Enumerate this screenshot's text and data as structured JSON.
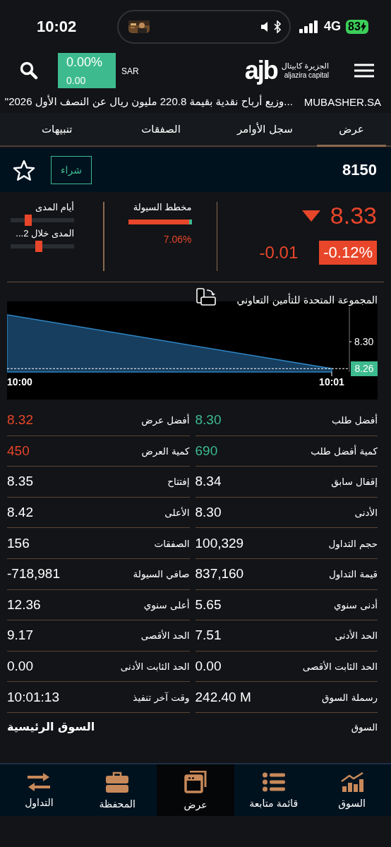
{
  "status_bar": {
    "time": "10:02",
    "network": "4G",
    "battery": "83"
  },
  "header": {
    "change_percent": "0.00%",
    "change_value": "0.00",
    "currency": "SAR",
    "logo": "ajb",
    "brand_arabic": "الجزيرة كابيتال",
    "brand_latin": "aljazira capital"
  },
  "ticker": {
    "source": "MUBASHER.SA",
    "headline": "...وزيع أرباح نقدية بقيمة 220.8 مليون ريال عن النصف الأول 2026\""
  },
  "tabs": [
    {
      "label": "عرض",
      "selected": true
    },
    {
      "label": "سجل الأوامر",
      "selected": false
    },
    {
      "label": "الصفقات",
      "selected": false
    },
    {
      "label": "تنبيهات",
      "selected": false
    }
  ],
  "symbol": {
    "code": "8150",
    "buy_label": "شراء",
    "starred": false
  },
  "quote": {
    "price": "8.33",
    "falling": true,
    "change": "-0.01",
    "change_percent": "-0.12%",
    "liquidity": {
      "label": "مخطط السيولة",
      "level": 0.96,
      "reading": "7.06%"
    },
    "ranges": [
      {
        "label": "أيام المدى",
        "level": 0.28
      },
      {
        "label": "المدى خلال 2...",
        "level": 0.44
      }
    ]
  },
  "chart": {
    "title": "المجموعة المتحدة للتأمين التعاوني",
    "start_time": "10:00",
    "end_time": "10:01",
    "price_label": "8.30",
    "last_price": "8.26"
  },
  "stats": [
    {
      "label": "أفضل طلب",
      "value": "8.30",
      "color": "#3dbb8f"
    },
    {
      "label": "أفضل عرض",
      "value": "8.32",
      "color": "#e8462a"
    },
    {
      "label": "كمية أفضل طلب",
      "value": "690",
      "color": "#3dbb8f"
    },
    {
      "label": "كمية العرض",
      "value": "450",
      "color": "#e8462a"
    },
    {
      "label": "إقفال سابق",
      "value": "8.34",
      "color": "#ffffff"
    },
    {
      "label": "إفتتاح",
      "value": "8.35",
      "color": "#ffffff"
    },
    {
      "label": "الأدنى",
      "value": "8.30",
      "color": "#ffffff"
    },
    {
      "label": "الأعلى",
      "value": "8.42",
      "color": "#ffffff"
    },
    {
      "label": "حجم التداول",
      "value": "100,329",
      "color": "#ffffff"
    },
    {
      "label": "الصفقات",
      "value": "156",
      "color": "#ffffff"
    },
    {
      "label": "قيمة التداول",
      "value": "837,160",
      "color": "#ffffff"
    },
    {
      "label": "صافي السيولة",
      "value": "-718,981",
      "color": "#ffffff"
    },
    {
      "label": "أدنى سنوي",
      "value": "5.65",
      "color": "#ffffff"
    },
    {
      "label": "أعلى سنوي",
      "value": "12.36",
      "color": "#ffffff"
    },
    {
      "label": "الحد الأدنى",
      "value": "7.51",
      "color": "#ffffff"
    },
    {
      "label": "الحد الأقصى",
      "value": "9.17",
      "color": "#ffffff"
    },
    {
      "label": "الحد الثابت الأقصى",
      "value": "0.00",
      "color": "#ffffff"
    },
    {
      "label": "الحد الثابت الأدنى",
      "value": "0.00",
      "color": "#ffffff"
    },
    {
      "label": "رسملة السوق",
      "value": "242.40 M",
      "color": "#ffffff"
    },
    {
      "label": "وقت آخر تنفيذ",
      "value": "10:01:13",
      "color": "#ffffff"
    }
  ],
  "market": {
    "label": "السوق",
    "value": "السوق الرئيسية"
  },
  "nav": [
    {
      "label": "السوق",
      "selected": false
    },
    {
      "label": "قائمة متابعة",
      "selected": false
    },
    {
      "label": "عرض",
      "selected": true
    },
    {
      "label": "المحفظة",
      "selected": false
    },
    {
      "label": "التداول",
      "selected": false
    }
  ]
}
